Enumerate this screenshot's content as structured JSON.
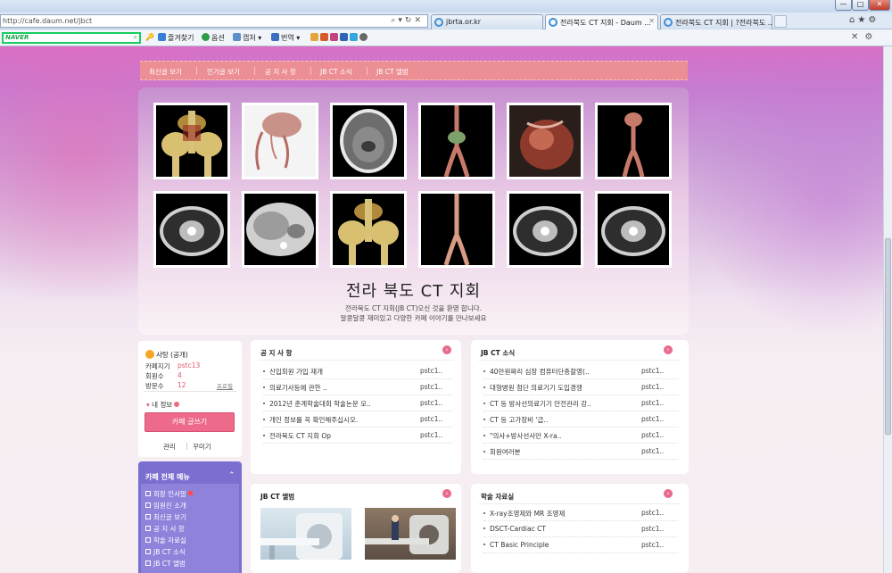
{
  "browser": {
    "address": "http://cafe.daum.net/jbct",
    "tabs": [
      {
        "label": "jbrta.or.kr",
        "active": false
      },
      {
        "label": "전라북도 CT 지회 - Daum ...",
        "active": true
      },
      {
        "label": "전라북도 CT 지회 | ?전라북도 ...",
        "active": false
      }
    ],
    "window_buttons": {
      "minimize": "—",
      "maximize": "□",
      "close": "✕"
    }
  },
  "toolbar": {
    "naver_logo": "NAVER",
    "items": [
      "즐겨찾기",
      "옵션",
      "캡처 ▾",
      "번역 ▾"
    ],
    "close_glyph": "✕"
  },
  "cafe_menu": {
    "items": [
      "최신글 보기",
      "인기글 보기",
      "공 지 사 항",
      "JB CT 소식",
      "JB CT 앨범"
    ]
  },
  "header": {
    "title": "전라 북도 CT 지회",
    "description_line1": "전라북도 CT 지회(JB CT)오신 것을 환영 합니다.",
    "description_line2": "알콩달콩 재미있고 다양한 카페 이야기를 만나보세요"
  },
  "profile": {
    "owner_label": "사탕 (공개)",
    "rows": [
      {
        "label": "카페지기",
        "value": "pstc13"
      },
      {
        "label": "회원수",
        "value": "4"
      },
      {
        "label": "방문수",
        "value": "12"
      }
    ],
    "profile_link": "프로필",
    "my_info": "내 정보",
    "write_button": "카페 글쓰기",
    "manage_link": "관리",
    "decorate_link": "꾸미기"
  },
  "full_menu": {
    "title": "카페 전체 메뉴",
    "items": [
      "회장 인사말",
      "임원진 소개",
      "최신글 보기",
      "공 지 사 항",
      "학술 자료실",
      "JB CT 소식",
      "JB CT 앨범"
    ]
  },
  "boards": {
    "notice": {
      "title": "공 지 사 항",
      "posts": [
        {
          "title": "신입회원 가입 재개",
          "author": "pstc1.."
        },
        {
          "title": "의료기사등에 관한 ..",
          "author": "pstc1.."
        },
        {
          "title": "2012년 춘계학술대회 학술논문 모..",
          "author": "pstc1.."
        },
        {
          "title": "개인 정보를 꼭 확인해주십시오.",
          "author": "pstc1.."
        },
        {
          "title": "전라북도 CT 지회 Op",
          "author": "pstc1.."
        }
      ]
    },
    "news": {
      "title": "JB CT 소식",
      "posts": [
        {
          "title": "40만원짜리 심장 컴퓨터단층촬영(..",
          "author": "pstc1.."
        },
        {
          "title": "대형병원 첨단 의료기기 도입경쟁",
          "author": "pstc1.."
        },
        {
          "title": "CT 등 방사선의료기기 안전관리 강..",
          "author": "pstc1.."
        },
        {
          "title": "CT 등 고가장비 '급..",
          "author": "pstc1.."
        },
        {
          "title": "\"의사+방사선사만 X-ra..",
          "author": "pstc1.."
        },
        {
          "title": "회원여러분",
          "author": "pstc1.."
        }
      ]
    },
    "album": {
      "title": "JB CT 앨범"
    },
    "academic": {
      "title": "학술 자료실",
      "posts": [
        {
          "title": "X-ray조영제와 MR 조영제",
          "author": "pstc1.."
        },
        {
          "title": "DSCT-Cardiac CT",
          "author": "pstc1.."
        },
        {
          "title": "CT Basic Principle",
          "author": "pstc1.."
        }
      ]
    }
  },
  "colors": {
    "menu_bar": "#ec8f94",
    "accent_pink": "#ee6a8a",
    "full_menu_purple": "#7b6ed1",
    "author_red": "#e2576c"
  }
}
